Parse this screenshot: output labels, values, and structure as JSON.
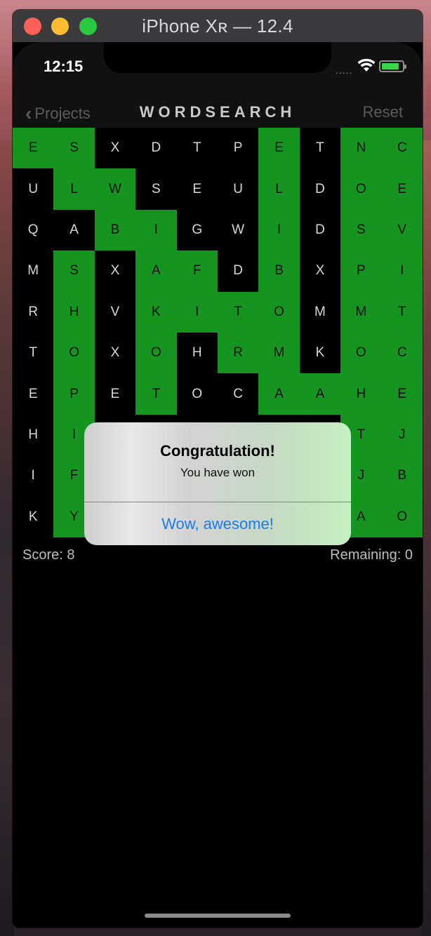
{
  "window": {
    "title": "iPhone Xʀ — 12.4"
  },
  "status": {
    "time": "12:15",
    "signal": "....."
  },
  "nav": {
    "back_label": "Projects",
    "title": "WORDSEARCH",
    "reset_label": "Reset"
  },
  "grid": {
    "letters": [
      [
        "E",
        "S",
        "X",
        "D",
        "T",
        "P",
        "E",
        "T",
        "N",
        "C"
      ],
      [
        "U",
        "L",
        "W",
        "S",
        "E",
        "U",
        "L",
        "D",
        "O",
        "E"
      ],
      [
        "Q",
        "A",
        "B",
        "I",
        "G",
        "W",
        "I",
        "D",
        "S",
        "V"
      ],
      [
        "M",
        "S",
        "X",
        "A",
        "F",
        "D",
        "B",
        "X",
        "P",
        "I"
      ],
      [
        "R",
        "H",
        "V",
        "K",
        "I",
        "T",
        "O",
        "M",
        "M",
        "T"
      ],
      [
        "T",
        "O",
        "X",
        "O",
        "H",
        "R",
        "M",
        "K",
        "O",
        "C"
      ],
      [
        "E",
        "P",
        "E",
        "T",
        "O",
        "C",
        "A",
        "A",
        "H",
        "E"
      ],
      [
        "H",
        "I",
        "",
        "",
        "",
        "",
        "",
        "",
        "T",
        "J"
      ],
      [
        "I",
        "F",
        "",
        "",
        "",
        "",
        "",
        "",
        "J",
        "B"
      ],
      [
        "K",
        "Y",
        "",
        "",
        "",
        "",
        "",
        "",
        "A",
        "O"
      ]
    ],
    "highlighted": [
      [
        1,
        1,
        0,
        0,
        0,
        0,
        1,
        0,
        1,
        1
      ],
      [
        0,
        1,
        1,
        0,
        0,
        0,
        1,
        0,
        1,
        1
      ],
      [
        0,
        0,
        1,
        1,
        0,
        0,
        1,
        0,
        1,
        1
      ],
      [
        0,
        1,
        0,
        1,
        1,
        0,
        1,
        0,
        1,
        1
      ],
      [
        0,
        1,
        0,
        1,
        1,
        1,
        1,
        0,
        1,
        1
      ],
      [
        0,
        1,
        0,
        1,
        0,
        1,
        1,
        0,
        1,
        1
      ],
      [
        0,
        1,
        0,
        1,
        0,
        0,
        1,
        1,
        1,
        1
      ],
      [
        0,
        1,
        0,
        0,
        0,
        0,
        0,
        0,
        1,
        1
      ],
      [
        0,
        1,
        0,
        0,
        0,
        0,
        0,
        0,
        1,
        1
      ],
      [
        0,
        1,
        0,
        0,
        0,
        0,
        0,
        0,
        1,
        1
      ]
    ],
    "highlight_color": "#15951f"
  },
  "footer": {
    "score": "Score: 8",
    "remaining": "Remaining: 0"
  },
  "alert": {
    "title": "Congratulation!",
    "message": "You have won",
    "button": "Wow, awesome!"
  }
}
